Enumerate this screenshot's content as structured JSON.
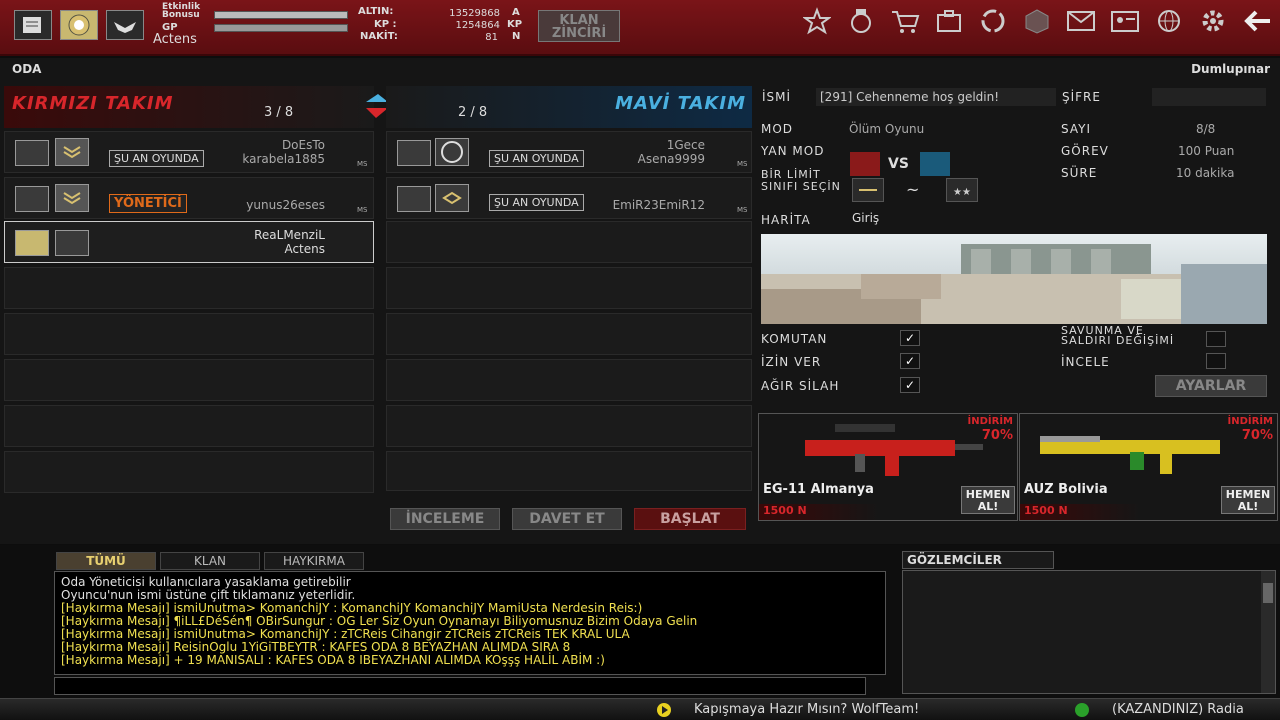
{
  "topbar": {
    "event_bonus_label": "Etkinlik\nBonusu",
    "gp_label": "GP",
    "player_name": "Actens",
    "altin_label": "ALTIN:",
    "altin_value": "13529868",
    "altin_unit": "A",
    "kp_label": "KP :",
    "kp_value": "1254864",
    "kp_unit": "KP",
    "nakit_label": "NAKİT:",
    "nakit_value": "81",
    "nakit_unit": "N",
    "clan_chain_label": "KLAN\nZİNCİRİ",
    "icons": [
      "star-icon",
      "medal-icon",
      "cart-icon",
      "inventory-icon",
      "recycle-icon",
      "box-icon",
      "mail-icon",
      "profile-card-icon",
      "globe-icon",
      "gear-icon",
      "back-arrow-icon"
    ]
  },
  "room": {
    "title": "ODA",
    "server": "Dumlupınar",
    "red_team": {
      "title": "KIRMIZI TAKIM",
      "count": "3 / 8",
      "players": [
        {
          "status": "ŞU AN OYUNDA",
          "line1": "DoEsTo",
          "line2": "karabela1885",
          "ms": "MS"
        },
        {
          "status": "YÖNETİCİ",
          "line1": "",
          "line2": "yunus26eses",
          "ms": "MS"
        },
        {
          "status": "",
          "line1": "ReaLMenziL",
          "line2": "Actens",
          "ms": ""
        }
      ]
    },
    "blue_team": {
      "title": "MAVİ TAKIM",
      "count": "2 / 8",
      "players": [
        {
          "status": "ŞU AN OYUNDA",
          "line1": "1Gece",
          "line2": "Asena9999",
          "ms": "MS"
        },
        {
          "status": "ŞU AN OYUNDA",
          "line1": "",
          "line2": "EmiR23EmiR12",
          "ms": "MS"
        }
      ]
    },
    "buttons": {
      "inspect": "İNCELEME",
      "invite": "DAVET ET",
      "start": "BAŞLAT"
    }
  },
  "settings": {
    "name_label": "İSMİ",
    "name_value": "[291] Cehenneme hoş geldin!",
    "password_label": "ŞİFRE",
    "mode_label": "MOD",
    "mode_value": "Ölüm Oyunu",
    "count_label": "SAYI",
    "count_value": "8/8",
    "submode_label": "YAN MOD",
    "vs_label": "VS",
    "task_label": "GÖREV",
    "task_value": "100 Puan",
    "limit_label": "BİR LİMİT\nSINIFI SEÇİN",
    "limit_tilde": "~",
    "time_label": "SÜRE",
    "time_value": "10 dakika",
    "map_label": "HARİTA",
    "map_value": "Giriş",
    "options": [
      {
        "label": "KOMUTAN",
        "checked": true
      },
      {
        "label": "İZİN VER",
        "checked": true
      },
      {
        "label": "AĞIR SİLAH",
        "checked": true
      }
    ],
    "right_options": [
      {
        "label": "SAVUNMA VE\nSALDIRI DEĞİŞİMİ",
        "checked": false
      },
      {
        "label": "İNCELE",
        "checked": false
      }
    ],
    "settings_button": "AYARLAR",
    "check_mark": "✓"
  },
  "shop": [
    {
      "name": "EG-11 Almanya",
      "discount_label": "İNDİRİM",
      "discount": "70%",
      "price": "1500 N",
      "buy": "HEMEN\nAL!",
      "accent": "#c8201c"
    },
    {
      "name": "AUZ Bolivia",
      "discount_label": "İNDİRİM",
      "discount": "70%",
      "price": "1500 N",
      "buy": "HEMEN\nAL!",
      "accent": "#d8c020"
    }
  ],
  "chat": {
    "tabs": [
      "TÜMÜ",
      "KLAN",
      "HAYKIRMA"
    ],
    "lines": [
      {
        "text": "Oda Yöneticisi kullanıcılara yasaklama getirebilir",
        "color": "#e0e0e0"
      },
      {
        "text": "Oyuncu'nun ismi üstüne çift tıklamanız yeterlidir.",
        "color": "#e0e0e0"
      },
      {
        "text": "[Haykırma Mesajı] ismiUnutma>   KomanchiJY : KomanchiJY KomanchiJY MamiUsta Nerdesin Reis:)",
        "color": "#f0e050"
      },
      {
        "text": "[Haykırma Mesajı] ¶iLL£DéSén¶  OBirSungur :  OG Ler Siz Oyun Oynamayı Biliyomusnuz Bizim Odaya Gelin",
        "color": "#f0e050"
      },
      {
        "text": "[Haykırma Mesajı] ismiUnutma>   KomanchiJY : zTCReis Cihangir zTCReis zTCReis TEK KRAL ULA",
        "color": "#f0e050"
      },
      {
        "text": "[Haykırma Mesajı] ReisinOglu    1YiGiTBEYTR : KAFES ODA 8 BEYAZHAN ALIMDA SIRA 8",
        "color": "#f0e050"
      },
      {
        "text": "[Haykırma Mesajı] + 19          MANISALI : KAFES ODA 8 IBEYAZHANI ALIMDA KOşşş HALİL ABİM :)",
        "color": "#f0e050"
      }
    ],
    "input_value": "",
    "observers_title": "GÖZLEMCİLER"
  },
  "ticker": {
    "text1": "Kapışmaya Hazır Mısın? WolfTeam!",
    "text2": "(KAZANDINIZ) Radia"
  },
  "colors": {
    "red_team": "#d8262b",
    "blue_team": "#4ab0e0",
    "top_bar": "#6e1114"
  }
}
